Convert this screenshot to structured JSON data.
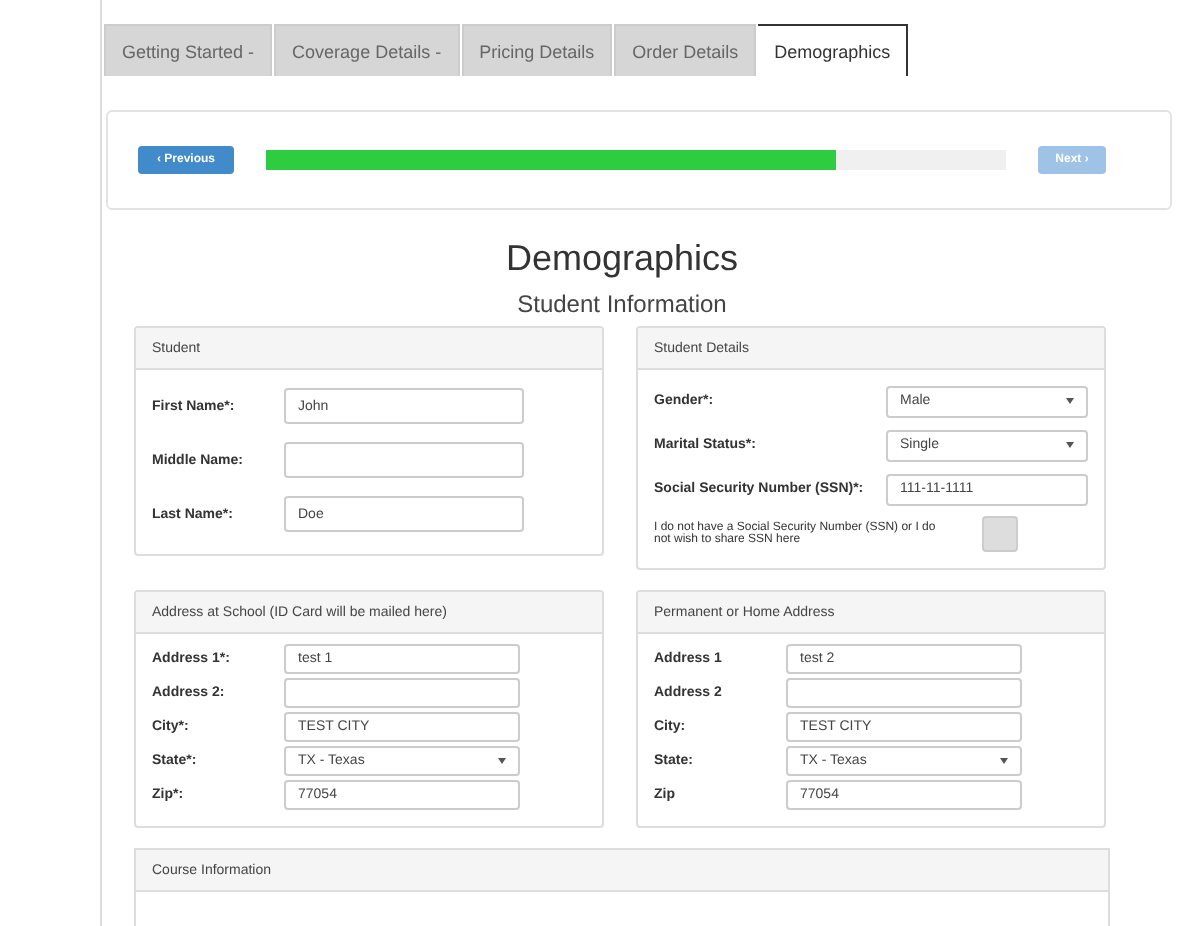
{
  "tabs": [
    {
      "label": "Getting Started -",
      "selected": false
    },
    {
      "label": "Coverage Details -",
      "selected": false
    },
    {
      "label": "Pricing Details",
      "selected": false
    },
    {
      "label": "Order Details",
      "selected": false
    },
    {
      "label": "Demographics",
      "selected": true
    }
  ],
  "progress": {
    "previous": "‹ Previous",
    "next": "Next ›",
    "level": 0.77
  },
  "title": "Demographics",
  "subtitle": "Student Information",
  "panels": [
    {
      "title": "Student",
      "fields": [
        {
          "kind": "text",
          "label": "First Name*:",
          "value": "John"
        },
        {
          "kind": "text",
          "label": "Middle Name:"
        },
        {
          "kind": "text",
          "label": "Last Name*:",
          "value": "Doe"
        }
      ]
    },
    {
      "title": "Student Details",
      "fields": [
        {
          "kind": "select",
          "label": "Gender*:",
          "value": "Male"
        },
        {
          "kind": "select",
          "label": "Marital Status*:",
          "value": "Single"
        },
        {
          "kind": "text",
          "label": "Social Security Number (SSN)*:",
          "value": "111-11-1111"
        },
        {
          "kind": "checkbox",
          "label": "I do not have a Social Security Number (SSN) or I do not wish to share SSN here",
          "checked": false
        }
      ]
    },
    {
      "title": "Address at School (ID Card will be mailed here)",
      "fields": [
        {
          "kind": "text",
          "label": "Address 1*:",
          "value": "test 1"
        },
        {
          "kind": "text",
          "label": "Address 2:"
        },
        {
          "kind": "text",
          "label": "City*:",
          "value": "TEST CITY"
        },
        {
          "kind": "select",
          "label": "State*:",
          "value": "TX - Texas"
        },
        {
          "kind": "text",
          "label": "Zip*:",
          "value": "77054"
        }
      ]
    },
    {
      "title": "Permanent or Home Address",
      "fields": [
        {
          "kind": "text",
          "label": "Address 1",
          "value": "test 2"
        },
        {
          "kind": "text",
          "label": "Address 2"
        },
        {
          "kind": "text",
          "label": "City:",
          "value": "TEST CITY"
        },
        {
          "kind": "select",
          "label": "State:",
          "value": "TX - Texas"
        },
        {
          "kind": "text",
          "label": "Zip",
          "value": "77054"
        }
      ]
    }
  ],
  "course": {
    "title": "Course Information"
  }
}
